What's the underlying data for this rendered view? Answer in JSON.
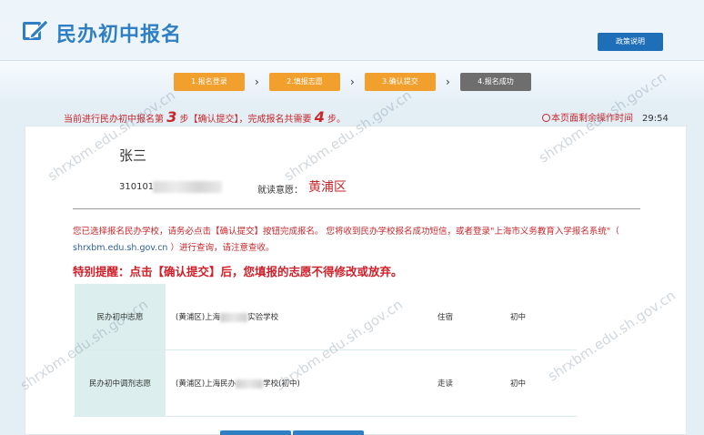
{
  "header": {
    "title": "民办初中报名",
    "policy_button": "政策说明"
  },
  "steps": [
    {
      "label": "1.报名登录",
      "state": "done"
    },
    {
      "label": "2.填报志愿",
      "state": "done"
    },
    {
      "label": "3.确认提交",
      "state": "current"
    },
    {
      "label": "4.报名成功",
      "state": "pending"
    }
  ],
  "progress": {
    "prefix": "当前进行民办初中报名第",
    "current_step": "3",
    "middle": "步【确认提交】，完成报名共需要",
    "total_steps": "4",
    "suffix": "步。"
  },
  "timer": {
    "label": "本页面剩余操作时间",
    "value": "29:54"
  },
  "student": {
    "name": "张三",
    "id_prefix": "310101",
    "district_label": "就读意愿：",
    "district_value": "黄浦区"
  },
  "notice": {
    "text1": "您已选择报名民办学校，请务必点击【确认提交】按钮完成报名。 您将收到民办学校报名成功短信，或者登录\"上海市义务教育入学报名系统\"（ ",
    "link": "shrxbm.edu.sh.gov.cn",
    "text2": " ）进行查询，请注意查收。"
  },
  "alert": "特别提醒：点击【确认提交】后，您填报的志愿不得修改或放弃。",
  "choices": [
    {
      "label": "民办初中志愿",
      "school_prefix": "(黄浦区)上海",
      "school_suffix": "实验学校",
      "mode": "住宿",
      "level": "初中"
    },
    {
      "label": "民办初中调剂志愿",
      "school_prefix": "(黄浦区)上海民办",
      "school_suffix": "学校(初中)",
      "mode": "走读",
      "level": "初中"
    }
  ],
  "watermark": "shrxbm.edu.sh.gov.cn",
  "colors": {
    "brand_blue": "#2f7fc4",
    "step_orange": "#f1a02d",
    "step_gray": "#6e6e6e",
    "alert_red": "#c8262b"
  }
}
